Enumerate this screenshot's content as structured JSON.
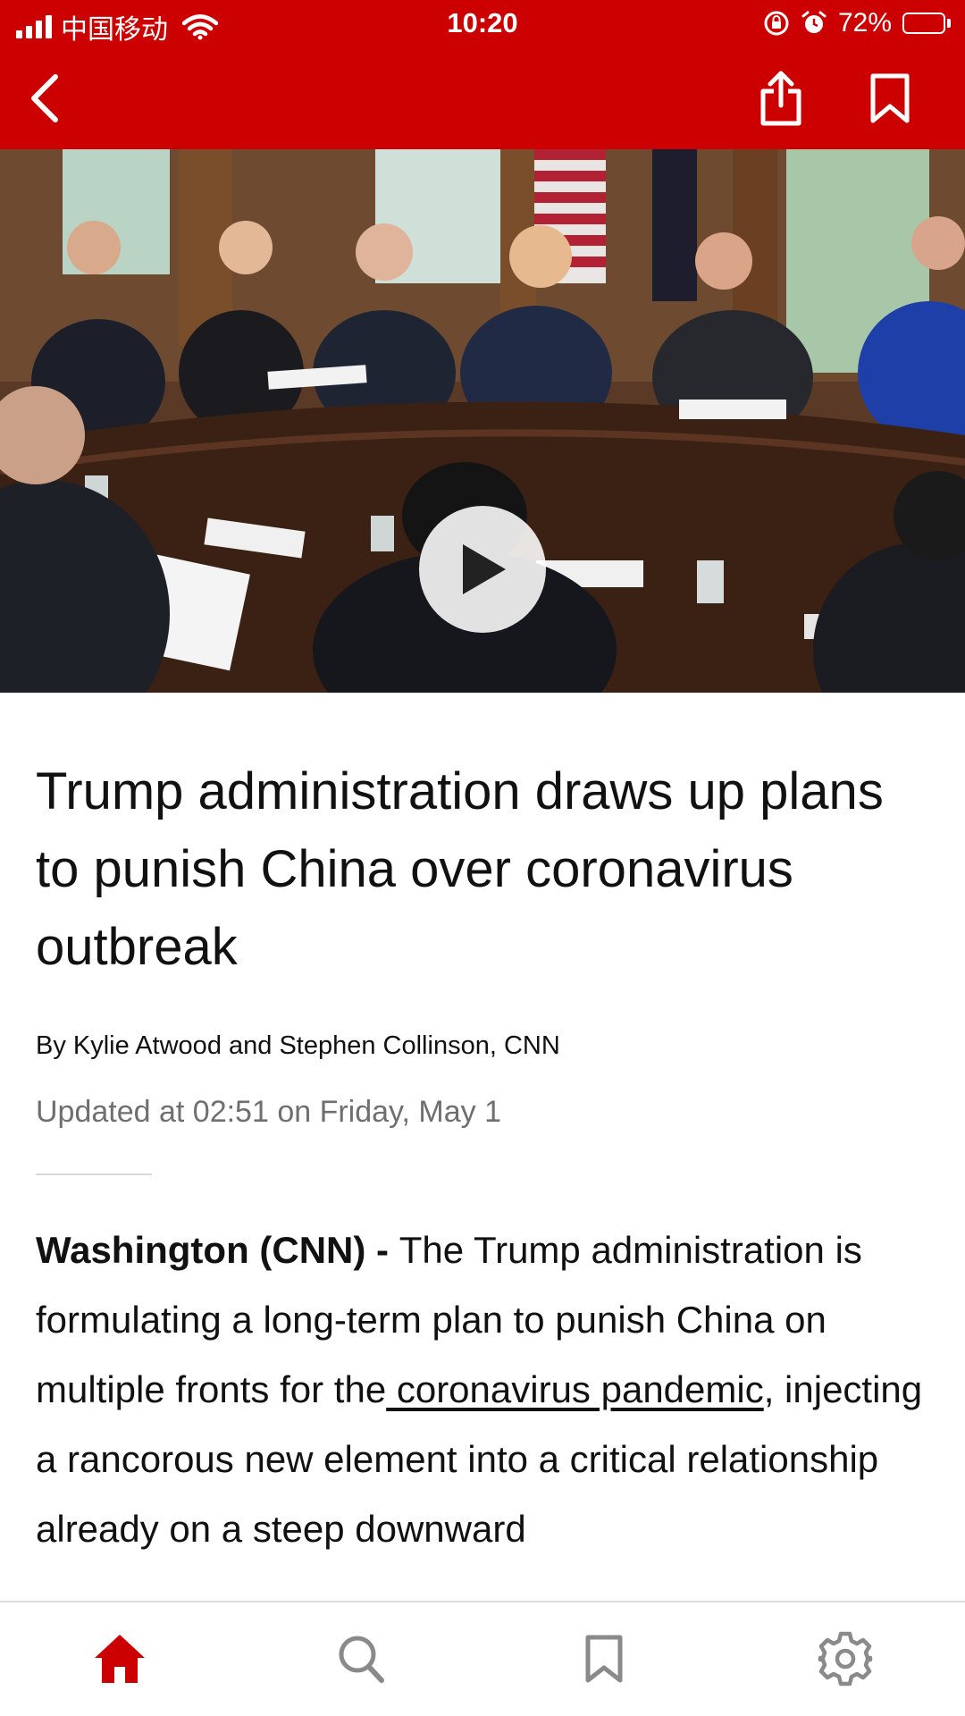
{
  "status_bar": {
    "carrier": "中国移动",
    "time": "10:20",
    "battery": "72%",
    "battery_level": 0.72
  },
  "header": {
    "back_icon": "chevron-left-icon",
    "share_icon": "share-icon",
    "bookmark_icon": "bookmark-icon"
  },
  "hero": {
    "play_icon": "play-icon"
  },
  "article": {
    "headline": "Trump administration draws up plans to punish China over coronavirus outbreak",
    "byline": "By Kylie Atwood and Stephen Collinson, CNN",
    "updated": "Updated at 02:51 on Friday, May 1",
    "dateline": "Washington  (CNN) - ",
    "body_intro": "The Trump administration is formulating a long-term plan to punish China on multiple fronts for the",
    "link_text": " coronavirus pandemic",
    "body_rest": ", injecting a rancorous new element into a critical relationship already on a steep downward"
  },
  "bottom_nav": {
    "items": [
      {
        "icon": "home-icon"
      },
      {
        "icon": "search-icon"
      },
      {
        "icon": "bookmark-icon"
      },
      {
        "icon": "gear-icon"
      }
    ]
  },
  "colors": {
    "brand_red": "#cc0000",
    "text": "#111111",
    "muted": "#6f6f6f"
  }
}
